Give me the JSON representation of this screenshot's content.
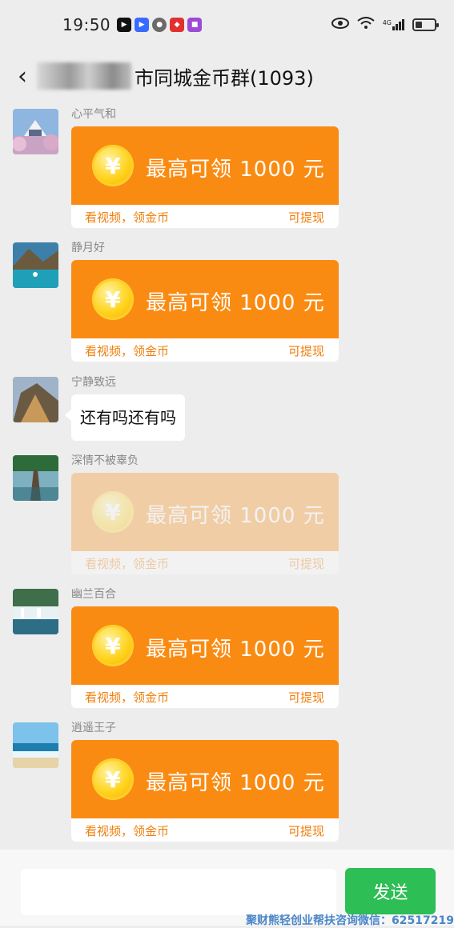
{
  "status_bar": {
    "time": "19:50",
    "network": "4G"
  },
  "header": {
    "title": "市同城金币群(1093)"
  },
  "reward_card": {
    "coin_symbol": "¥",
    "headline": "最高可领 1000 元",
    "footer_left": "看视频，领金币",
    "footer_right": "可提现"
  },
  "messages": [
    {
      "sender": "心平气和",
      "type": "card"
    },
    {
      "sender": "静月好",
      "type": "card"
    },
    {
      "sender": "宁静致远",
      "type": "text",
      "text": "还有吗还有吗"
    },
    {
      "sender": "深情不被辜负",
      "type": "card",
      "faded": true
    },
    {
      "sender": "幽兰百合",
      "type": "card"
    },
    {
      "sender": "逍遥王子",
      "type": "card"
    }
  ],
  "input_bar": {
    "send_label": "发送"
  },
  "watermark": "聚财熊轻创业帮扶咨询微信：62517219",
  "colors": {
    "card_orange": "#fa8b12",
    "send_green": "#2dbe55",
    "background": "#ededed"
  }
}
